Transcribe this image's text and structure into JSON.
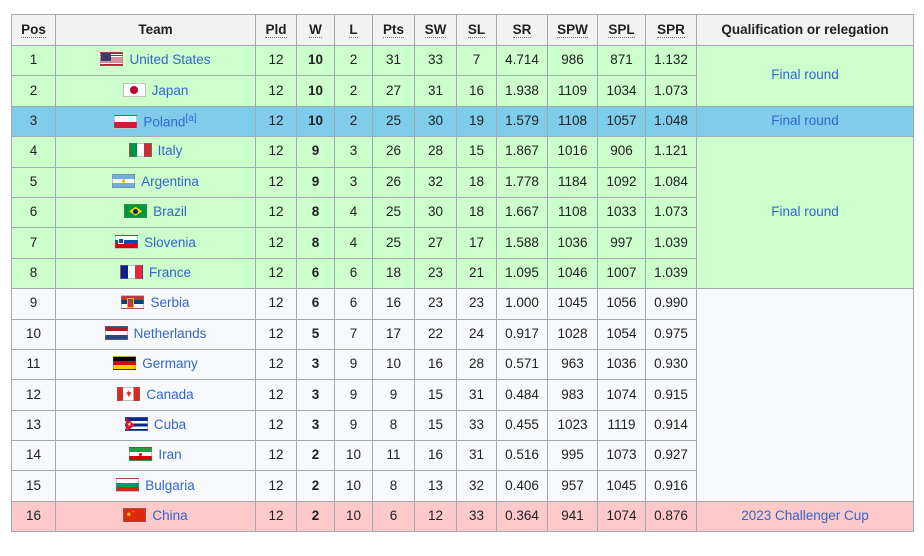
{
  "table": {
    "columns": [
      {
        "key": "pos",
        "label": "Pos",
        "abbr": true
      },
      {
        "key": "team",
        "label": "Team",
        "abbr": false
      },
      {
        "key": "pld",
        "label": "Pld",
        "abbr": true
      },
      {
        "key": "w",
        "label": "W",
        "abbr": true
      },
      {
        "key": "l",
        "label": "L",
        "abbr": true
      },
      {
        "key": "pts",
        "label": "Pts",
        "abbr": true
      },
      {
        "key": "sw",
        "label": "SW",
        "abbr": true
      },
      {
        "key": "sl",
        "label": "SL",
        "abbr": true
      },
      {
        "key": "sr",
        "label": "SR",
        "abbr": true
      },
      {
        "key": "spw",
        "label": "SPW",
        "abbr": true
      },
      {
        "key": "spl",
        "label": "SPL",
        "abbr": true
      },
      {
        "key": "spr",
        "label": "SPR",
        "abbr": true
      },
      {
        "key": "qual",
        "label": "Qualification or relegation",
        "abbr": false
      }
    ],
    "rows": [
      {
        "pos": "1",
        "team": "United States",
        "flag": "f-us",
        "flag_name": "flag-united-states",
        "note": "",
        "pld": "12",
        "w": "10",
        "l": "2",
        "pts": "31",
        "sw": "33",
        "sl": "7",
        "sr": "4.714",
        "spw": "986",
        "spl": "871",
        "spr": "1.132",
        "tint": "green"
      },
      {
        "pos": "2",
        "team": "Japan",
        "flag": "f-jp",
        "flag_name": "flag-japan",
        "note": "",
        "pld": "12",
        "w": "10",
        "l": "2",
        "pts": "27",
        "sw": "31",
        "sl": "16",
        "sr": "1.938",
        "spw": "1109",
        "spl": "1034",
        "spr": "1.073",
        "tint": "green"
      },
      {
        "pos": "3",
        "team": "Poland",
        "flag": "f-pl",
        "flag_name": "flag-poland",
        "note": "[a]",
        "pld": "12",
        "w": "10",
        "l": "2",
        "pts": "25",
        "sw": "30",
        "sl": "19",
        "sr": "1.579",
        "spw": "1108",
        "spl": "1057",
        "spr": "1.048",
        "tint": "blue"
      },
      {
        "pos": "4",
        "team": "Italy",
        "flag": "f-it",
        "flag_name": "flag-italy",
        "note": "",
        "pld": "12",
        "w": "9",
        "l": "3",
        "pts": "26",
        "sw": "28",
        "sl": "15",
        "sr": "1.867",
        "spw": "1016",
        "spl": "906",
        "spr": "1.121",
        "tint": "green"
      },
      {
        "pos": "5",
        "team": "Argentina",
        "flag": "f-ar",
        "flag_name": "flag-argentina",
        "note": "",
        "pld": "12",
        "w": "9",
        "l": "3",
        "pts": "26",
        "sw": "32",
        "sl": "18",
        "sr": "1.778",
        "spw": "1184",
        "spl": "1092",
        "spr": "1.084",
        "tint": "green"
      },
      {
        "pos": "6",
        "team": "Brazil",
        "flag": "f-br",
        "flag_name": "flag-brazil",
        "note": "",
        "pld": "12",
        "w": "8",
        "l": "4",
        "pts": "25",
        "sw": "30",
        "sl": "18",
        "sr": "1.667",
        "spw": "1108",
        "spl": "1033",
        "spr": "1.073",
        "tint": "green"
      },
      {
        "pos": "7",
        "team": "Slovenia",
        "flag": "f-si",
        "flag_name": "flag-slovenia",
        "note": "",
        "pld": "12",
        "w": "8",
        "l": "4",
        "pts": "25",
        "sw": "27",
        "sl": "17",
        "sr": "1.588",
        "spw": "1036",
        "spl": "997",
        "spr": "1.039",
        "tint": "green"
      },
      {
        "pos": "8",
        "team": "France",
        "flag": "f-fr",
        "flag_name": "flag-france",
        "note": "",
        "pld": "12",
        "w": "6",
        "l": "6",
        "pts": "18",
        "sw": "23",
        "sl": "21",
        "sr": "1.095",
        "spw": "1046",
        "spl": "1007",
        "spr": "1.039",
        "tint": "green"
      },
      {
        "pos": "9",
        "team": "Serbia",
        "flag": "f-rs",
        "flag_name": "flag-serbia",
        "note": "",
        "pld": "12",
        "w": "6",
        "l": "6",
        "pts": "16",
        "sw": "23",
        "sl": "23",
        "sr": "1.000",
        "spw": "1045",
        "spl": "1056",
        "spr": "0.990",
        "tint": "plain"
      },
      {
        "pos": "10",
        "team": "Netherlands",
        "flag": "f-nl",
        "flag_name": "flag-netherlands",
        "note": "",
        "pld": "12",
        "w": "5",
        "l": "7",
        "pts": "17",
        "sw": "22",
        "sl": "24",
        "sr": "0.917",
        "spw": "1028",
        "spl": "1054",
        "spr": "0.975",
        "tint": "plain"
      },
      {
        "pos": "11",
        "team": "Germany",
        "flag": "f-de",
        "flag_name": "flag-germany",
        "note": "",
        "pld": "12",
        "w": "3",
        "l": "9",
        "pts": "10",
        "sw": "16",
        "sl": "28",
        "sr": "0.571",
        "spw": "963",
        "spl": "1036",
        "spr": "0.930",
        "tint": "plain"
      },
      {
        "pos": "12",
        "team": "Canada",
        "flag": "f-ca",
        "flag_name": "flag-canada",
        "note": "",
        "pld": "12",
        "w": "3",
        "l": "9",
        "pts": "9",
        "sw": "15",
        "sl": "31",
        "sr": "0.484",
        "spw": "983",
        "spl": "1074",
        "spr": "0.915",
        "tint": "plain"
      },
      {
        "pos": "13",
        "team": "Cuba",
        "flag": "f-cu",
        "flag_name": "flag-cuba",
        "note": "",
        "pld": "12",
        "w": "3",
        "l": "9",
        "pts": "8",
        "sw": "15",
        "sl": "33",
        "sr": "0.455",
        "spw": "1023",
        "spl": "1119",
        "spr": "0.914",
        "tint": "plain"
      },
      {
        "pos": "14",
        "team": "Iran",
        "flag": "f-ir",
        "flag_name": "flag-iran",
        "note": "",
        "pld": "12",
        "w": "2",
        "l": "10",
        "pts": "11",
        "sw": "16",
        "sl": "31",
        "sr": "0.516",
        "spw": "995",
        "spl": "1073",
        "spr": "0.927",
        "tint": "plain"
      },
      {
        "pos": "15",
        "team": "Bulgaria",
        "flag": "f-bg",
        "flag_name": "flag-bulgaria",
        "note": "",
        "pld": "12",
        "w": "2",
        "l": "10",
        "pts": "8",
        "sw": "13",
        "sl": "32",
        "sr": "0.406",
        "spw": "957",
        "spl": "1045",
        "spr": "0.916",
        "tint": "plain"
      },
      {
        "pos": "16",
        "team": "China",
        "flag": "f-cn",
        "flag_name": "flag-china",
        "note": "",
        "pld": "12",
        "w": "2",
        "l": "10",
        "pts": "6",
        "sw": "12",
        "sl": "33",
        "sr": "0.364",
        "spw": "941",
        "spl": "1074",
        "spr": "0.876",
        "tint": "pink"
      }
    ],
    "qualification_groups": [
      {
        "label": "Final round",
        "start": 0,
        "span": 2,
        "tint": "green"
      },
      {
        "label": "Final round",
        "start": 2,
        "span": 1,
        "tint": "blue"
      },
      {
        "label": "Final round",
        "start": 3,
        "span": 5,
        "tint": "green"
      },
      {
        "label": "",
        "start": 8,
        "span": 7,
        "tint": "plain"
      },
      {
        "label": "2023 Challenger Cup",
        "start": 15,
        "span": 1,
        "tint": "pink"
      }
    ]
  },
  "colors": {
    "green": "#ccffcc",
    "blue": "#7fcdeb",
    "pink": "#fdc9c9",
    "plain": "#f8f9fa",
    "link": "#3366cc",
    "border": "#a2a9b1",
    "header_bg": "#f2f2f3"
  }
}
